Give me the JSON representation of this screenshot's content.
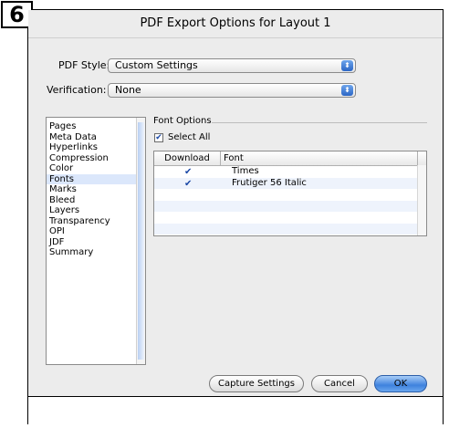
{
  "step_badge": "6",
  "window": {
    "title": "PDF Export Options for Layout 1"
  },
  "pdf_style": {
    "label": "PDF Style:",
    "value": "Custom Settings"
  },
  "verification": {
    "label": "Verification:",
    "value": "None"
  },
  "sidebar": {
    "items": [
      {
        "label": "Pages"
      },
      {
        "label": "Meta Data"
      },
      {
        "label": "Hyperlinks"
      },
      {
        "label": "Compression"
      },
      {
        "label": "Color"
      },
      {
        "label": "Fonts",
        "selected": true
      },
      {
        "label": "Marks"
      },
      {
        "label": "Bleed"
      },
      {
        "label": "Layers"
      },
      {
        "label": "Transparency"
      },
      {
        "label": "OPI"
      },
      {
        "label": "JDF"
      },
      {
        "label": "Summary"
      }
    ]
  },
  "font_options": {
    "group_title": "Font Options",
    "select_all_label": "Select All",
    "select_all_checked": true,
    "table": {
      "columns": [
        "Download",
        "Font"
      ],
      "rows": [
        {
          "download": true,
          "font": "Times"
        },
        {
          "download": true,
          "font": "Frutiger 56 Italic"
        }
      ]
    }
  },
  "buttons": {
    "capture": "Capture Settings",
    "cancel": "Cancel",
    "ok": "OK"
  },
  "icons": {
    "check": "✔",
    "popup_arrows": "⬍"
  }
}
